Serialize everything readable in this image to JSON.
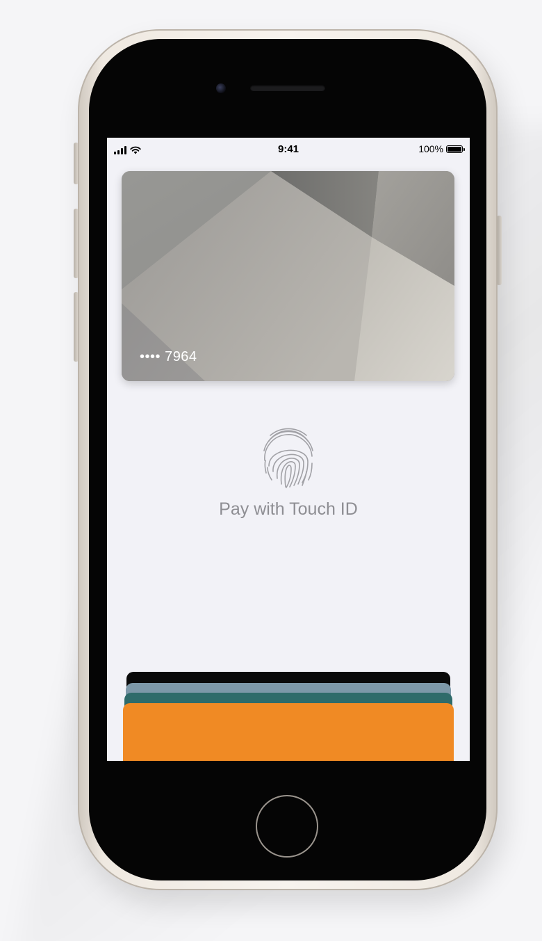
{
  "status_bar": {
    "time": "9:41",
    "battery_percent": "100%",
    "battery_level": 1.0,
    "signal_icon": "cellular-signal-icon",
    "wifi_icon": "wifi-icon"
  },
  "card": {
    "number_masked": "•••• 7964"
  },
  "payment": {
    "prompt": "Pay with Touch ID",
    "icon": "fingerprint-icon"
  },
  "card_stack": {
    "colors": [
      "#0a0a0a",
      "#7d98a8",
      "#2f6b6a",
      "#f08a24"
    ]
  },
  "colors": {
    "screen_background": "#f2f2f7",
    "prompt_text": "#8e8e93",
    "device_frame": "#efe9e1"
  }
}
